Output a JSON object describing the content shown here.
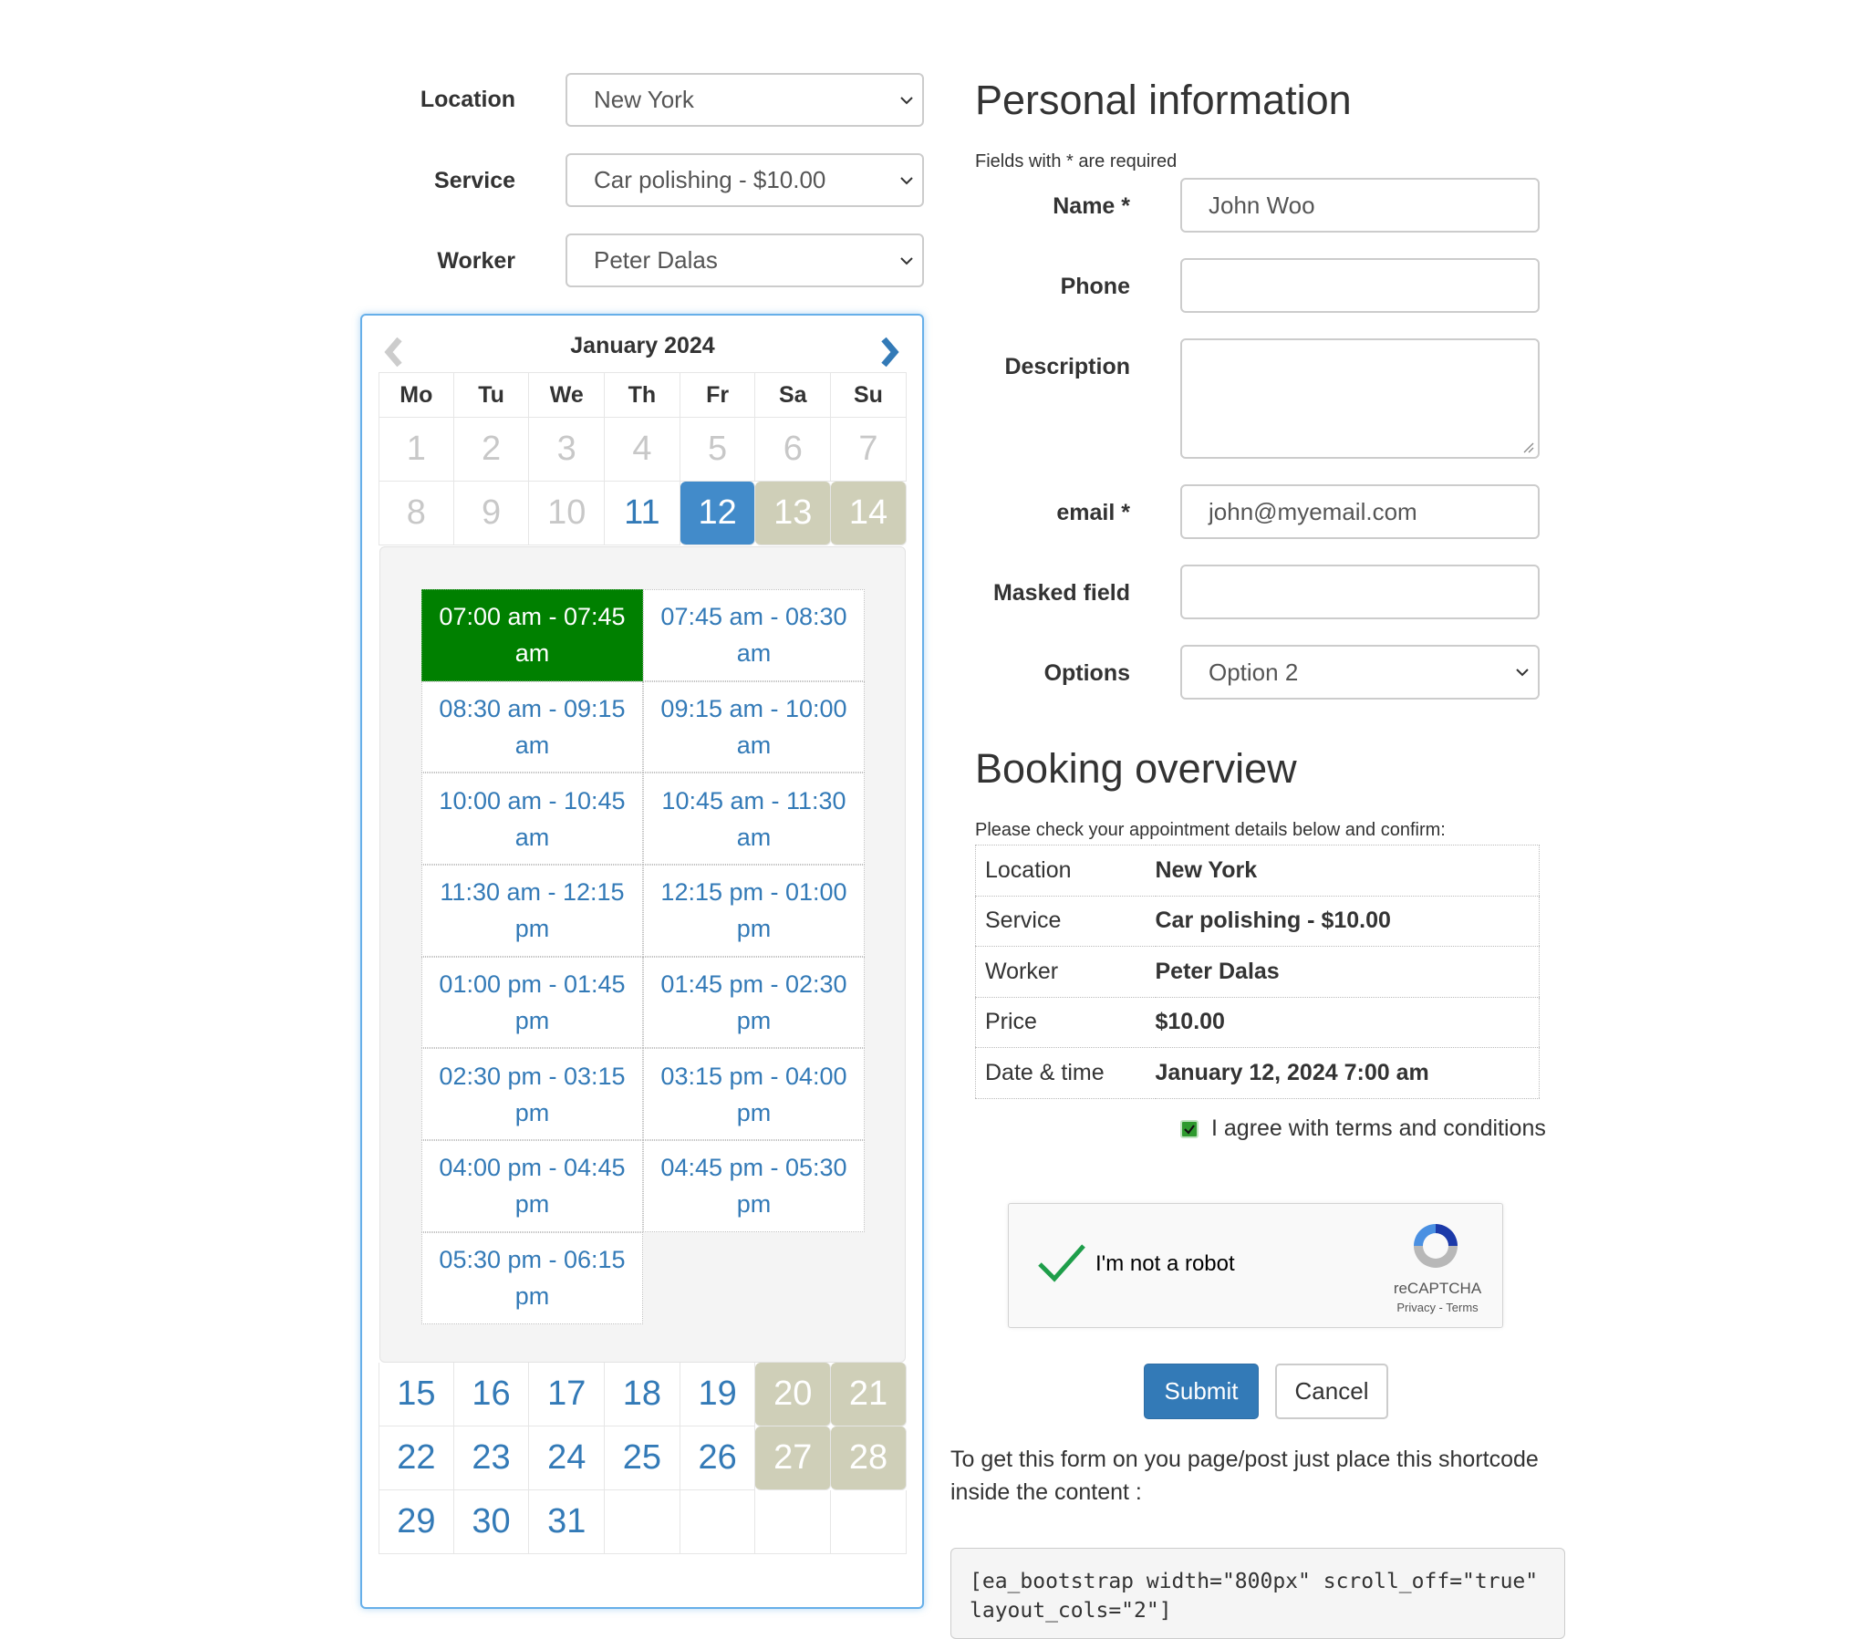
{
  "selectors": {
    "location": {
      "label": "Location",
      "value": "New York"
    },
    "service": {
      "label": "Service",
      "value": "Car polishing - $10.00"
    },
    "worker": {
      "label": "Worker",
      "value": "Peter Dalas"
    }
  },
  "calendar": {
    "month_title": "January 2024",
    "prev_icon": "chevron-left-icon",
    "next_icon": "chevron-right-icon",
    "weekdays": [
      "Mo",
      "Tu",
      "We",
      "Th",
      "Fr",
      "Sa",
      "Su"
    ],
    "weeks": [
      [
        {
          "d": "1",
          "s": "past"
        },
        {
          "d": "2",
          "s": "past"
        },
        {
          "d": "3",
          "s": "past"
        },
        {
          "d": "4",
          "s": "past"
        },
        {
          "d": "5",
          "s": "past"
        },
        {
          "d": "6",
          "s": "past"
        },
        {
          "d": "7",
          "s": "past"
        }
      ],
      [
        {
          "d": "8",
          "s": "past"
        },
        {
          "d": "9",
          "s": "past"
        },
        {
          "d": "10",
          "s": "past"
        },
        {
          "d": "11",
          "s": "free"
        },
        {
          "d": "12",
          "s": "selected"
        },
        {
          "d": "13",
          "s": "weekend"
        },
        {
          "d": "14",
          "s": "weekend"
        }
      ],
      [
        {
          "d": "15",
          "s": "free"
        },
        {
          "d": "16",
          "s": "free"
        },
        {
          "d": "17",
          "s": "free"
        },
        {
          "d": "18",
          "s": "free"
        },
        {
          "d": "19",
          "s": "free"
        },
        {
          "d": "20",
          "s": "weekend"
        },
        {
          "d": "21",
          "s": "weekend"
        }
      ],
      [
        {
          "d": "22",
          "s": "free"
        },
        {
          "d": "23",
          "s": "free"
        },
        {
          "d": "24",
          "s": "free"
        },
        {
          "d": "25",
          "s": "free"
        },
        {
          "d": "26",
          "s": "free"
        },
        {
          "d": "27",
          "s": "weekend"
        },
        {
          "d": "28",
          "s": "weekend"
        }
      ],
      [
        {
          "d": "29",
          "s": "free"
        },
        {
          "d": "30",
          "s": "free"
        },
        {
          "d": "31",
          "s": "free"
        },
        {
          "d": "",
          "s": "empty"
        },
        {
          "d": "",
          "s": "empty"
        },
        {
          "d": "",
          "s": "empty"
        },
        {
          "d": "",
          "s": "empty"
        }
      ]
    ],
    "time_slots": [
      {
        "label": "07:00 am - 07:45 am",
        "selected": true
      },
      {
        "label": "07:45 am - 08:30 am",
        "selected": false
      },
      {
        "label": "08:30 am - 09:15 am",
        "selected": false
      },
      {
        "label": "09:15 am - 10:00 am",
        "selected": false
      },
      {
        "label": "10:00 am - 10:45 am",
        "selected": false
      },
      {
        "label": "10:45 am - 11:30 am",
        "selected": false
      },
      {
        "label": "11:30 am - 12:15 pm",
        "selected": false
      },
      {
        "label": "12:15 pm - 01:00 pm",
        "selected": false
      },
      {
        "label": "01:00 pm - 01:45 pm",
        "selected": false
      },
      {
        "label": "01:45 pm - 02:30 pm",
        "selected": false
      },
      {
        "label": "02:30 pm - 03:15 pm",
        "selected": false
      },
      {
        "label": "03:15 pm - 04:00 pm",
        "selected": false
      },
      {
        "label": "04:00 pm - 04:45 pm",
        "selected": false
      },
      {
        "label": "04:45 pm - 05:30 pm",
        "selected": false
      },
      {
        "label": "05:30 pm - 06:15 pm",
        "selected": false
      }
    ]
  },
  "personal": {
    "title": "Personal information",
    "required_note": "Fields with * are required",
    "fields": {
      "name": {
        "label": "Name *",
        "value": "John Woo"
      },
      "phone": {
        "label": "Phone",
        "value": ""
      },
      "description": {
        "label": "Description",
        "value": ""
      },
      "email": {
        "label": "email *",
        "value": "john@myemail.com"
      },
      "masked": {
        "label": "Masked field",
        "value": ""
      },
      "options": {
        "label": "Options",
        "value": "Option 2"
      }
    }
  },
  "overview": {
    "title": "Booking overview",
    "note": "Please check your appointment details below and confirm:",
    "rows": [
      {
        "key": "Location",
        "value": "New York"
      },
      {
        "key": "Service",
        "value": "Car polishing - $10.00"
      },
      {
        "key": "Worker",
        "value": "Peter Dalas"
      },
      {
        "key": "Price",
        "value": "$10.00"
      },
      {
        "key": "Date & time",
        "value": "January 12, 2024 7:00 am"
      }
    ],
    "agree_label": "I agree with terms and conditions",
    "agree_checked": true
  },
  "recaptcha": {
    "label": "I'm not a robot",
    "brand": "reCAPTCHA",
    "links": "Privacy - Terms",
    "verified": true
  },
  "actions": {
    "submit": "Submit",
    "cancel": "Cancel"
  },
  "colors": {
    "primary": "#337ab7",
    "selected_day": "#428bca",
    "selected_slot": "#008000",
    "weekend": "#cfcfb8"
  },
  "shortcode": {
    "text": "To get this form on you page/post just place this shortcode inside the content :",
    "code": "[ea_bootstrap width=\"800px\" scroll_off=\"true\" layout_cols=\"2\"]"
  }
}
